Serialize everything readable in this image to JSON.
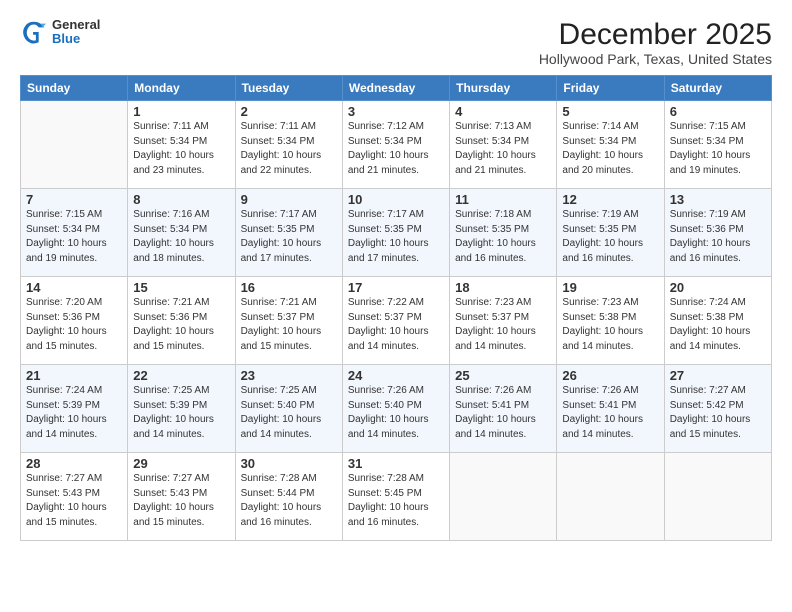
{
  "header": {
    "logo": {
      "line1": "General",
      "line2": "Blue"
    },
    "title": "December 2025",
    "subtitle": "Hollywood Park, Texas, United States"
  },
  "days_of_week": [
    "Sunday",
    "Monday",
    "Tuesday",
    "Wednesday",
    "Thursday",
    "Friday",
    "Saturday"
  ],
  "weeks": [
    [
      {
        "day": "",
        "info": ""
      },
      {
        "day": "1",
        "info": "Sunrise: 7:11 AM\nSunset: 5:34 PM\nDaylight: 10 hours\nand 23 minutes."
      },
      {
        "day": "2",
        "info": "Sunrise: 7:11 AM\nSunset: 5:34 PM\nDaylight: 10 hours\nand 22 minutes."
      },
      {
        "day": "3",
        "info": "Sunrise: 7:12 AM\nSunset: 5:34 PM\nDaylight: 10 hours\nand 21 minutes."
      },
      {
        "day": "4",
        "info": "Sunrise: 7:13 AM\nSunset: 5:34 PM\nDaylight: 10 hours\nand 21 minutes."
      },
      {
        "day": "5",
        "info": "Sunrise: 7:14 AM\nSunset: 5:34 PM\nDaylight: 10 hours\nand 20 minutes."
      },
      {
        "day": "6",
        "info": "Sunrise: 7:15 AM\nSunset: 5:34 PM\nDaylight: 10 hours\nand 19 minutes."
      }
    ],
    [
      {
        "day": "7",
        "info": "Sunrise: 7:15 AM\nSunset: 5:34 PM\nDaylight: 10 hours\nand 19 minutes."
      },
      {
        "day": "8",
        "info": "Sunrise: 7:16 AM\nSunset: 5:34 PM\nDaylight: 10 hours\nand 18 minutes."
      },
      {
        "day": "9",
        "info": "Sunrise: 7:17 AM\nSunset: 5:35 PM\nDaylight: 10 hours\nand 17 minutes."
      },
      {
        "day": "10",
        "info": "Sunrise: 7:17 AM\nSunset: 5:35 PM\nDaylight: 10 hours\nand 17 minutes."
      },
      {
        "day": "11",
        "info": "Sunrise: 7:18 AM\nSunset: 5:35 PM\nDaylight: 10 hours\nand 16 minutes."
      },
      {
        "day": "12",
        "info": "Sunrise: 7:19 AM\nSunset: 5:35 PM\nDaylight: 10 hours\nand 16 minutes."
      },
      {
        "day": "13",
        "info": "Sunrise: 7:19 AM\nSunset: 5:36 PM\nDaylight: 10 hours\nand 16 minutes."
      }
    ],
    [
      {
        "day": "14",
        "info": "Sunrise: 7:20 AM\nSunset: 5:36 PM\nDaylight: 10 hours\nand 15 minutes."
      },
      {
        "day": "15",
        "info": "Sunrise: 7:21 AM\nSunset: 5:36 PM\nDaylight: 10 hours\nand 15 minutes."
      },
      {
        "day": "16",
        "info": "Sunrise: 7:21 AM\nSunset: 5:37 PM\nDaylight: 10 hours\nand 15 minutes."
      },
      {
        "day": "17",
        "info": "Sunrise: 7:22 AM\nSunset: 5:37 PM\nDaylight: 10 hours\nand 14 minutes."
      },
      {
        "day": "18",
        "info": "Sunrise: 7:23 AM\nSunset: 5:37 PM\nDaylight: 10 hours\nand 14 minutes."
      },
      {
        "day": "19",
        "info": "Sunrise: 7:23 AM\nSunset: 5:38 PM\nDaylight: 10 hours\nand 14 minutes."
      },
      {
        "day": "20",
        "info": "Sunrise: 7:24 AM\nSunset: 5:38 PM\nDaylight: 10 hours\nand 14 minutes."
      }
    ],
    [
      {
        "day": "21",
        "info": "Sunrise: 7:24 AM\nSunset: 5:39 PM\nDaylight: 10 hours\nand 14 minutes."
      },
      {
        "day": "22",
        "info": "Sunrise: 7:25 AM\nSunset: 5:39 PM\nDaylight: 10 hours\nand 14 minutes."
      },
      {
        "day": "23",
        "info": "Sunrise: 7:25 AM\nSunset: 5:40 PM\nDaylight: 10 hours\nand 14 minutes."
      },
      {
        "day": "24",
        "info": "Sunrise: 7:26 AM\nSunset: 5:40 PM\nDaylight: 10 hours\nand 14 minutes."
      },
      {
        "day": "25",
        "info": "Sunrise: 7:26 AM\nSunset: 5:41 PM\nDaylight: 10 hours\nand 14 minutes."
      },
      {
        "day": "26",
        "info": "Sunrise: 7:26 AM\nSunset: 5:41 PM\nDaylight: 10 hours\nand 14 minutes."
      },
      {
        "day": "27",
        "info": "Sunrise: 7:27 AM\nSunset: 5:42 PM\nDaylight: 10 hours\nand 15 minutes."
      }
    ],
    [
      {
        "day": "28",
        "info": "Sunrise: 7:27 AM\nSunset: 5:43 PM\nDaylight: 10 hours\nand 15 minutes."
      },
      {
        "day": "29",
        "info": "Sunrise: 7:27 AM\nSunset: 5:43 PM\nDaylight: 10 hours\nand 15 minutes."
      },
      {
        "day": "30",
        "info": "Sunrise: 7:28 AM\nSunset: 5:44 PM\nDaylight: 10 hours\nand 16 minutes."
      },
      {
        "day": "31",
        "info": "Sunrise: 7:28 AM\nSunset: 5:45 PM\nDaylight: 10 hours\nand 16 minutes."
      },
      {
        "day": "",
        "info": ""
      },
      {
        "day": "",
        "info": ""
      },
      {
        "day": "",
        "info": ""
      }
    ]
  ]
}
